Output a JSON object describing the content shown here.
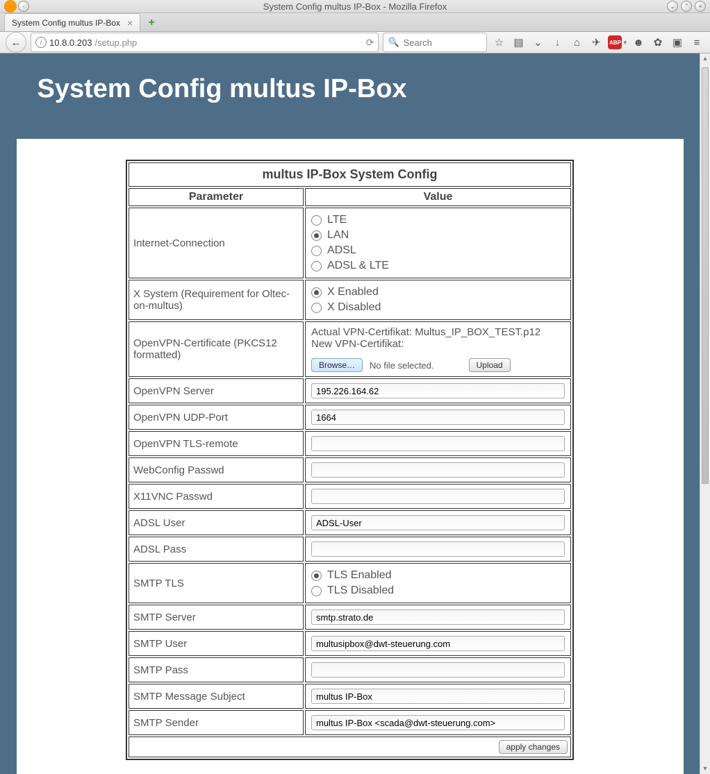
{
  "window": {
    "title": "System Config multus IP-Box - Mozilla Firefox"
  },
  "tab": {
    "label": "System Config multus IP-Box"
  },
  "url": {
    "host": "10.8.0.203",
    "path": "/setup.php"
  },
  "search": {
    "placeholder": "Search"
  },
  "page": {
    "heading": "System Config multus IP-Box",
    "table_title": "multus IP-Box System Config",
    "header": {
      "param": "Parameter",
      "value": "Value"
    },
    "rows": {
      "internet": {
        "label": "Internet-Connection",
        "options": [
          "LTE",
          "LAN",
          "ADSL",
          "ADSL & LTE"
        ],
        "selected": "LAN"
      },
      "xsystem": {
        "label": "X System (Requirement for Oltec-on-multus)",
        "options": [
          "X Enabled",
          "X Disabled"
        ],
        "selected": "X Enabled"
      },
      "vpncert": {
        "label": "OpenVPN-Certificate (PKCS12 formatted)",
        "actual_prefix": "Actual VPN-Certifikat: ",
        "actual_file": "Multus_IP_BOX_TEST.p12",
        "new_label": "New VPN-Certifikat:",
        "browse": "Browse…",
        "nofile": "No file selected.",
        "upload": "Upload"
      },
      "server": {
        "label": "OpenVPN Server",
        "value": "195.226.164.62"
      },
      "udp": {
        "label": "OpenVPN UDP-Port",
        "value": "1664"
      },
      "tls": {
        "label": "OpenVPN TLS-remote",
        "value": ""
      },
      "webpw": {
        "label": "WebConfig Passwd",
        "value": ""
      },
      "vncpw": {
        "label": "X11VNC Passwd",
        "value": ""
      },
      "adslu": {
        "label": "ADSL User",
        "value": "ADSL-User"
      },
      "adslp": {
        "label": "ADSL Pass",
        "value": ""
      },
      "smtptls": {
        "label": "SMTP TLS",
        "options": [
          "TLS Enabled",
          "TLS Disabled"
        ],
        "selected": "TLS Enabled"
      },
      "smtpsrv": {
        "label": "SMTP Server",
        "value": "smtp.strato.de"
      },
      "smtpusr": {
        "label": "SMTP User",
        "value": "multusipbox@dwt-steuerung.com"
      },
      "smtppw": {
        "label": "SMTP Pass",
        "value": ""
      },
      "smtpsubj": {
        "label": "SMTP Message Subject",
        "value": "multus IP-Box"
      },
      "smtpsnd": {
        "label": "SMTP Sender",
        "value": "multus IP-Box <scada@dwt-steuerung.com>"
      }
    },
    "apply": "apply changes"
  }
}
